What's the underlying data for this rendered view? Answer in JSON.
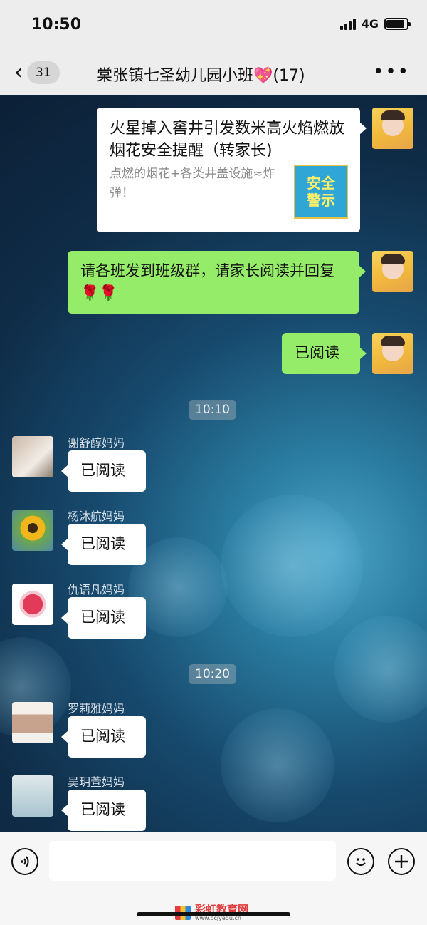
{
  "status_bar": {
    "time": "10:50",
    "network": "4G",
    "battery_level": 0.9
  },
  "nav": {
    "back_badge": "31",
    "title": "棠张镇七圣幼儿园小班",
    "title_emoji": "💖",
    "member_count": "(17)",
    "more": "•••"
  },
  "messages": [
    {
      "type": "link",
      "direction": "out",
      "title": "火星掉入窖井引发数米高火焰燃放烟花安全提醒（转家长)",
      "description": "点燃的烟花+各类井盖设施≈炸弹！",
      "thumbnail_text": [
        "安全",
        "警示"
      ]
    },
    {
      "type": "text",
      "direction": "out",
      "text": "请各班发到班级群，请家长阅读并回复",
      "emoji": "🌹🌹"
    },
    {
      "type": "text",
      "direction": "out",
      "text": "已阅读"
    }
  ],
  "time_separators": [
    "10:10",
    "10:20"
  ],
  "replies": [
    {
      "sender": "谢舒醇妈妈",
      "text": "已阅读"
    },
    {
      "sender": "杨沐航妈妈",
      "text": "已阅读"
    },
    {
      "sender": "仇语凡妈妈",
      "text": "已阅读"
    },
    {
      "sender": "罗莉雅妈妈",
      "text": "已阅读"
    },
    {
      "sender": "吴玥萱妈妈",
      "text": "已阅读"
    }
  ],
  "input_bar": {
    "voice_icon": "voice-icon",
    "emoji_icon": "emoji-icon",
    "plus_icon": "plus-icon"
  },
  "watermark": {
    "title": "彩虹教育网",
    "url": "www.pcjyedu.cn"
  }
}
